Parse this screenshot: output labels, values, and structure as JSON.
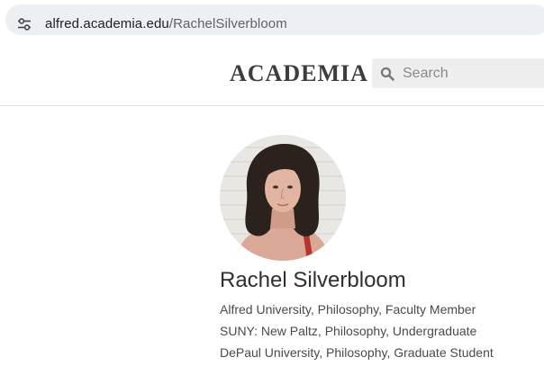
{
  "browser": {
    "url_domain": "alfred.academia.edu",
    "url_path": "/RachelSilverbloom",
    "site_info_icon": "tune-icon"
  },
  "header": {
    "logo": "ACADEMIA",
    "search": {
      "placeholder": "Search",
      "value": "",
      "icon": "search-icon"
    }
  },
  "profile": {
    "name": "Rachel Silverbloom",
    "avatar_icon": "profile-photo",
    "affiliations": [
      "Alfred University, Philosophy, Faculty Member",
      "SUNY: New Paltz, Philosophy, Undergraduate",
      "DePaul University, Philosophy, Graduate Student"
    ]
  },
  "colors": {
    "url_bar_bg": "#eceff4",
    "search_bg": "#eeeeee",
    "logo": "#3d3d3d",
    "text": "#4a4a4a"
  }
}
